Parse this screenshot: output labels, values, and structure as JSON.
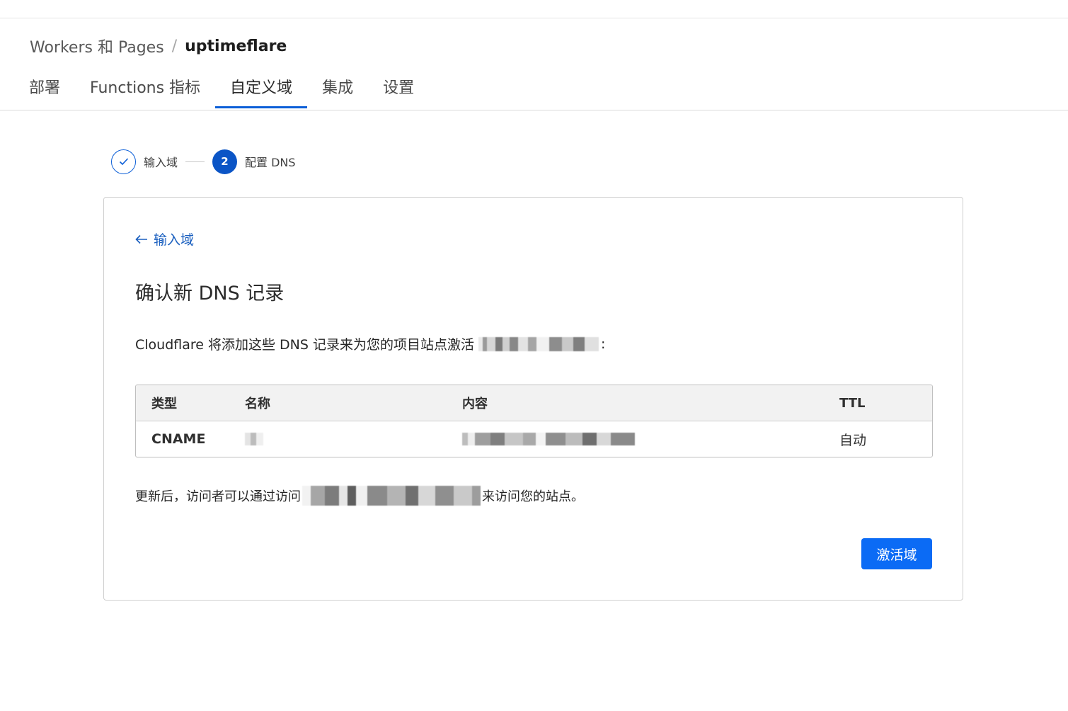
{
  "breadcrumb": {
    "parent": "Workers 和 Pages",
    "separator": "/",
    "current": "uptimeflare"
  },
  "tabs": [
    {
      "label": "部署",
      "active": false
    },
    {
      "label": "Functions 指标",
      "active": false
    },
    {
      "label": "自定义域",
      "active": true
    },
    {
      "label": "集成",
      "active": false
    },
    {
      "label": "设置",
      "active": false
    }
  ],
  "stepper": {
    "step1_label": "输入域",
    "step2_number": "2",
    "step2_label": "配置 DNS"
  },
  "card": {
    "back_label": "输入域",
    "title": "确认新 DNS 记录",
    "description": "Cloudflare 将添加这些 DNS 记录来为您的项目站点激活",
    "description_suffix": ":",
    "table": {
      "headers": {
        "type": "类型",
        "name": "名称",
        "content": "内容",
        "ttl": "TTL"
      },
      "rows": [
        {
          "type": "CNAME",
          "ttl": "自动"
        }
      ]
    },
    "after_prefix": "更新后，访问者可以通过访问",
    "after_suffix": "来访问您的站点。",
    "activate_label": "激活域"
  },
  "colors": {
    "accent": "#0b5ed7",
    "button": "#0b6bf5",
    "link": "#1a5fbf"
  },
  "icons": {
    "step_done": "check-icon",
    "back": "arrow-left-icon"
  }
}
